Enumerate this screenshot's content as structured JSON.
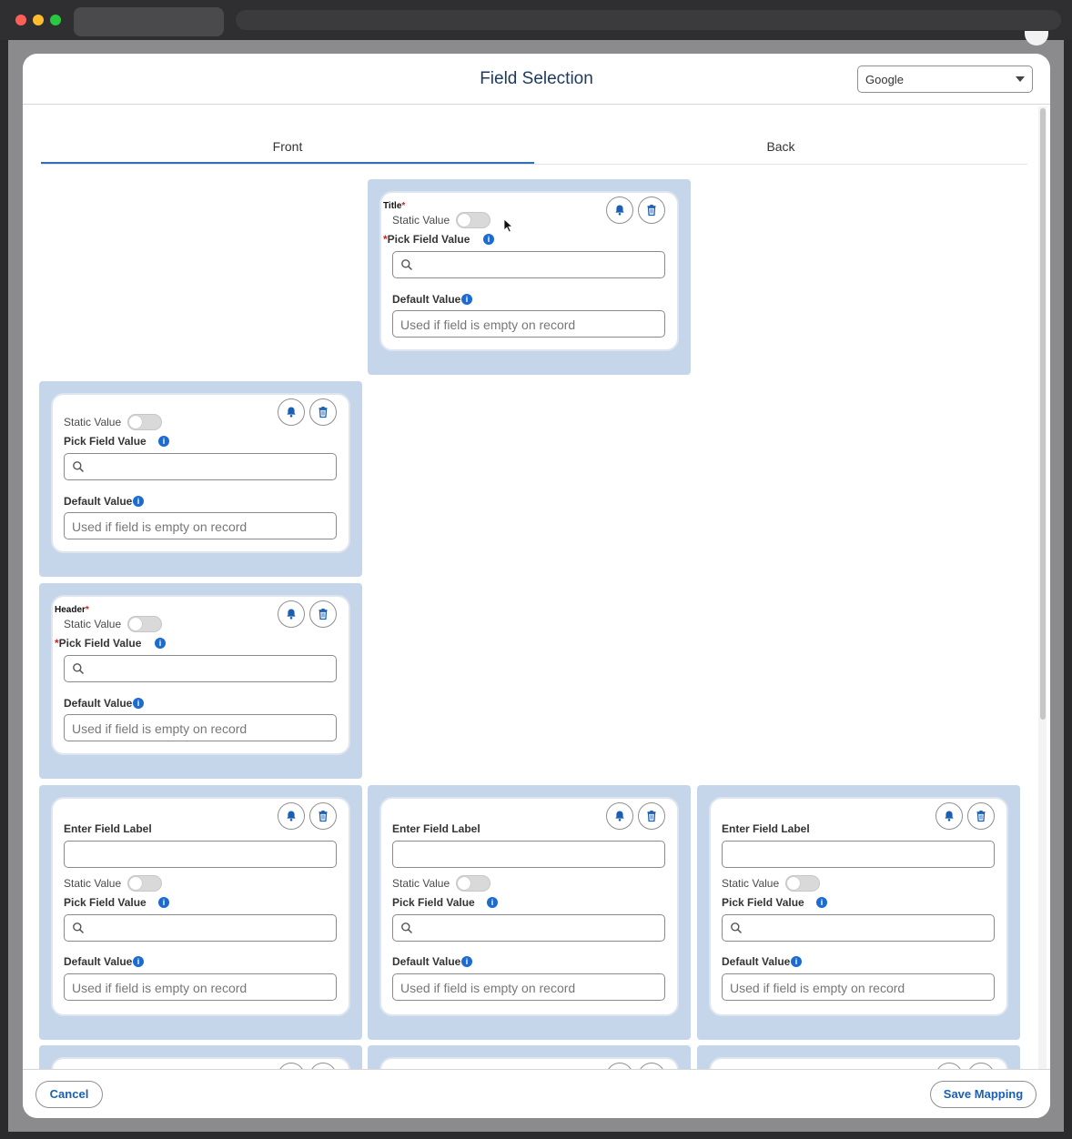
{
  "window": {
    "select_value": "Google"
  },
  "modal": {
    "title": "Field Selection"
  },
  "tabs": [
    {
      "label": "Front",
      "active": true
    },
    {
      "label": "Back",
      "active": false
    }
  ],
  "labels": {
    "static_value": "Static Value",
    "pick_field_value": "Pick Field Value",
    "default_value": "Default Value",
    "default_placeholder": "Used if field is empty on record",
    "enter_field_label": "Enter Field Label",
    "required_mark": "*",
    "info_glyph": "i"
  },
  "panels": [
    {
      "section_label": "Title",
      "required": true
    },
    {
      "section_label": "",
      "required": false
    },
    {
      "section_label": "Header",
      "required": true
    },
    {
      "type": "custom"
    },
    {
      "type": "custom"
    },
    {
      "type": "custom"
    }
  ],
  "icons": {
    "bell": "bell-icon",
    "trash": "trash-icon",
    "search": "search-icon",
    "info": "info-icon"
  },
  "colors": {
    "accent": "#2f6fb6",
    "panel_bg": "#c6d6ea",
    "info": "#1b6bd0",
    "required": "#d81e1e",
    "button_text": "#1b5fb3"
  },
  "footer": {
    "cancel_label": "Cancel",
    "save_label": "Save Mapping"
  }
}
